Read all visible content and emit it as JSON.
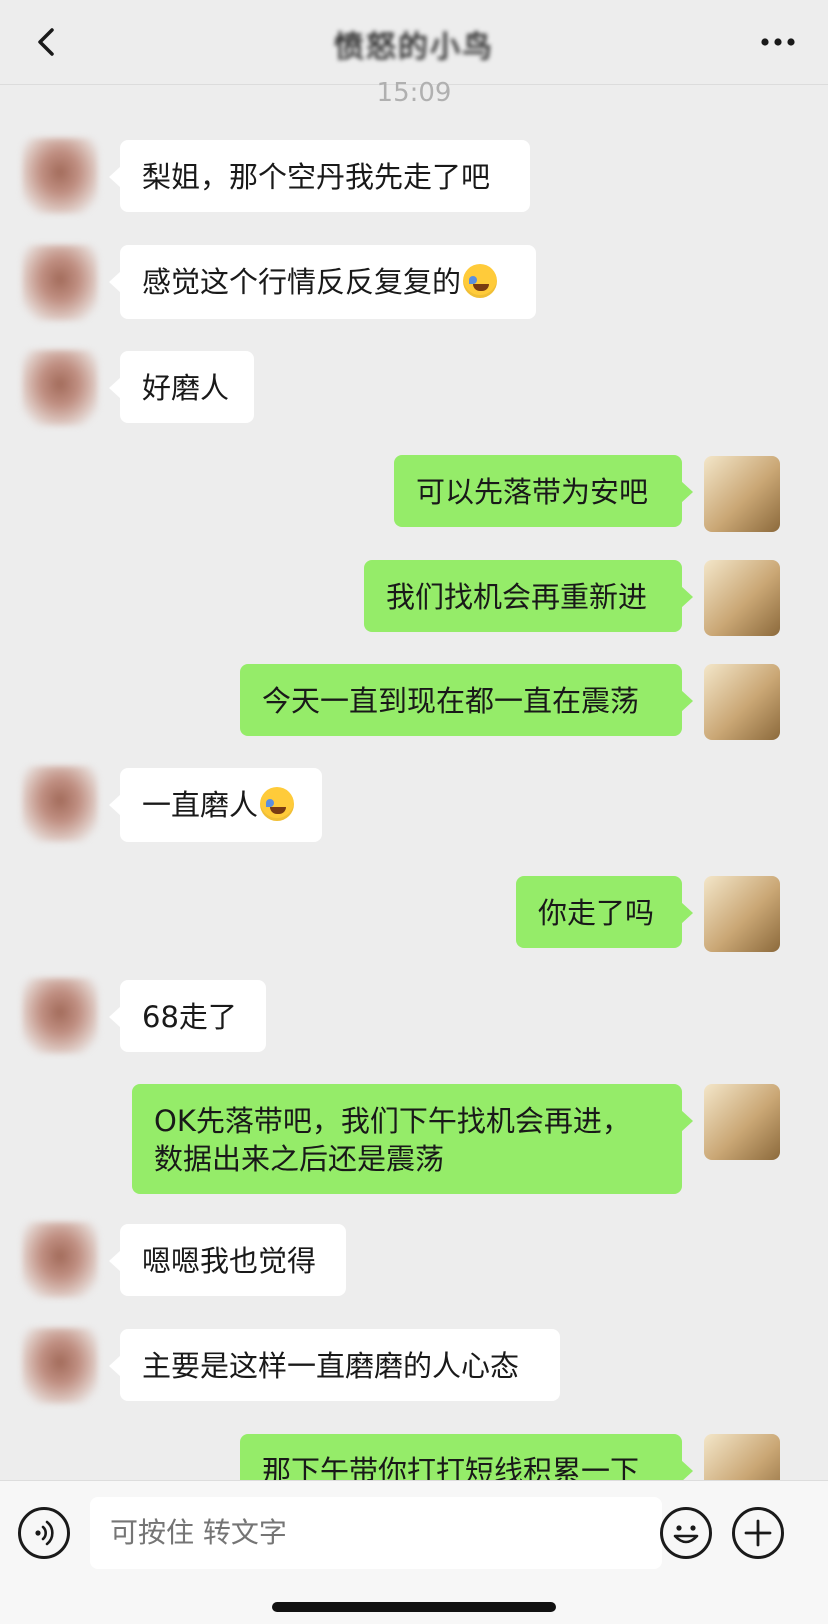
{
  "header": {
    "contact_name": "愤怒的小鸟",
    "back_icon": "chevron-left-icon",
    "more_icon": "more-dots-icon"
  },
  "timestamp": "15:09",
  "messages": [
    {
      "from": "peer",
      "text": "梨姐，那个空丹我先走了吧"
    },
    {
      "from": "peer",
      "text": "感觉这个行情反反复复的",
      "emoji": "crying-laughing-emoji"
    },
    {
      "from": "peer",
      "text": "好磨人"
    },
    {
      "from": "self",
      "text": "可以先落带为安吧"
    },
    {
      "from": "self",
      "text": "我们找机会再重新进"
    },
    {
      "from": "self",
      "text": "今天一直到现在都一直在震荡"
    },
    {
      "from": "peer",
      "text": "一直磨人",
      "emoji": "crying-laughing-emoji"
    },
    {
      "from": "self",
      "text": "你走了吗"
    },
    {
      "from": "peer",
      "text": "68走了"
    },
    {
      "from": "self",
      "text": "OK先落带吧，我们下午找机会再进，",
      "text2": "数据出来之后还是震荡"
    },
    {
      "from": "peer",
      "text": "嗯嗯我也觉得"
    },
    {
      "from": "peer",
      "text": "主要是这样一直磨磨的人心态"
    },
    {
      "from": "self",
      "text": "那下午带你打打短线积累一下"
    }
  ],
  "input_bar": {
    "voice_icon": "voice-icon",
    "placeholder": "可按住 转文字",
    "emoji_icon": "emoji-icon",
    "add_icon": "plus-icon"
  }
}
